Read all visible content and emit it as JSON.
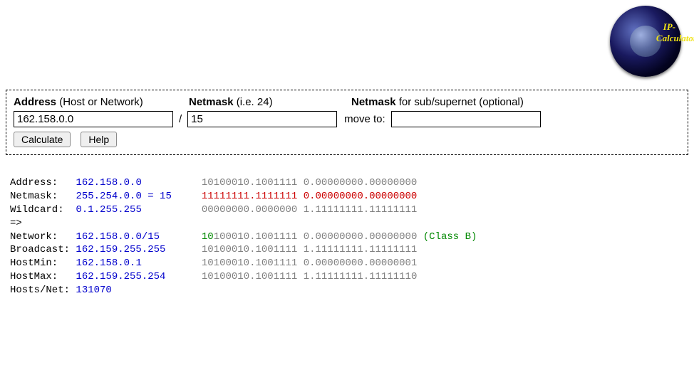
{
  "logo": {
    "text1": "IP-",
    "text2": "Calculator"
  },
  "form": {
    "labels": {
      "address_bold": "Address",
      "address_rest": " (Host or Network)",
      "mask_bold": "Netmask",
      "mask_rest": " (i.e. 24)",
      "opt_bold": "Netmask",
      "opt_rest": " for sub/supernet (optional)",
      "move_to": "move to:"
    },
    "inputs": {
      "address": "162.158.0.0",
      "mask": "15",
      "opt": ""
    },
    "buttons": {
      "calculate": "Calculate",
      "help": "Help"
    }
  },
  "results": [
    {
      "label": "Address:",
      "pad": "   ",
      "dec": "162.158.0.0",
      "dpad": "          ",
      "binNet": "10100010.1001111 ",
      "binHost": "0.00000000.00000000",
      "binNetClass": "gray",
      "binHostClass": "gray"
    },
    {
      "label": "Netmask:",
      "pad": "   ",
      "dec": "255.254.0.0 = 15",
      "dpad": "     ",
      "binNet": "11111111.1111111 ",
      "binHost": "0.00000000.00000000",
      "binNetClass": "red",
      "binHostClass": "red"
    },
    {
      "label": "Wildcard:",
      "pad": "  ",
      "dec": "0.1.255.255",
      "dpad": "          ",
      "binNet": "00000000.0000000 ",
      "binHost": "1.11111111.11111111",
      "binNetClass": "gray",
      "binHostClass": "gray"
    },
    {
      "label": "=>",
      "pad": "",
      "dec": "",
      "dpad": "",
      "binNet": "",
      "binHost": "",
      "binNetClass": "gray",
      "binHostClass": "gray"
    },
    {
      "label": "Network:",
      "pad": "   ",
      "dec": "162.158.0.0/15",
      "dpad": "       ",
      "binNet": "",
      "greenLead": "10",
      "restNet": "100010.1001111 ",
      "binHost": "0.00000000.00000000",
      "binHostClass": "gray",
      "class_suffix": " (Class B)"
    },
    {
      "label": "Broadcast:",
      "pad": " ",
      "dec": "162.159.255.255",
      "dpad": "      ",
      "binNet": "10100010.1001111 ",
      "binHost": "1.11111111.11111111",
      "binNetClass": "gray",
      "binHostClass": "gray"
    },
    {
      "label": "HostMin:",
      "pad": "   ",
      "dec": "162.158.0.1",
      "dpad": "          ",
      "binNet": "10100010.1001111 ",
      "binHost": "0.00000000.00000001",
      "binNetClass": "gray",
      "binHostClass": "gray"
    },
    {
      "label": "HostMax:",
      "pad": "   ",
      "dec": "162.159.255.254",
      "dpad": "      ",
      "binNet": "10100010.1001111 ",
      "binHost": "1.11111111.11111110",
      "binNetClass": "gray",
      "binHostClass": "gray"
    },
    {
      "label": "Hosts/Net:",
      "pad": " ",
      "dec": "131070",
      "dpad": "",
      "binNet": "",
      "binHost": "",
      "binNetClass": "gray",
      "binHostClass": "gray"
    }
  ]
}
